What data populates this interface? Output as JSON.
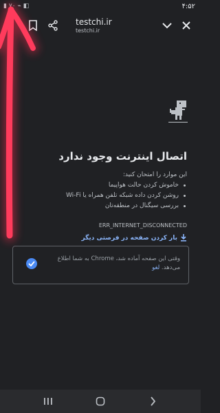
{
  "status_bar": {
    "time": "۴:۵۲",
    "icons_text": "▮ ٧٠ ⌁ ◧"
  },
  "toolbar": {
    "title": "testchi.ir",
    "subtitle": "testchi.ir",
    "icons": [
      "bookmark-icon",
      "share-icon",
      "chevron-down-icon",
      "close-icon"
    ]
  },
  "error_page": {
    "title": "اتصال اینترنت وجود ندارد",
    "try_text": "این موارد را امتحان کنید:",
    "suggestions": [
      "خاموش کردن حالت هواپیما",
      "روشن کردن داده شبکه تلفن همراه یا Wi-Fi",
      "بررسی سیگنال در منطقه‌تان"
    ],
    "error_code": "ERR_INTERNET_DISCONNECTED",
    "download_label": "بار کردن صفحه در فرصتی دیگر",
    "card": {
      "message": "وقتی این صفحه آماده شد، Chrome به شما اطلاع می‌دهد.",
      "cancel_label": "لغو"
    }
  },
  "nav_bar": {
    "icons": [
      "recent-apps-icon",
      "home-icon",
      "back-icon"
    ]
  },
  "colors": {
    "background": "#202124",
    "link": "#8ab4f8",
    "annotation": "#ff2a4f"
  }
}
